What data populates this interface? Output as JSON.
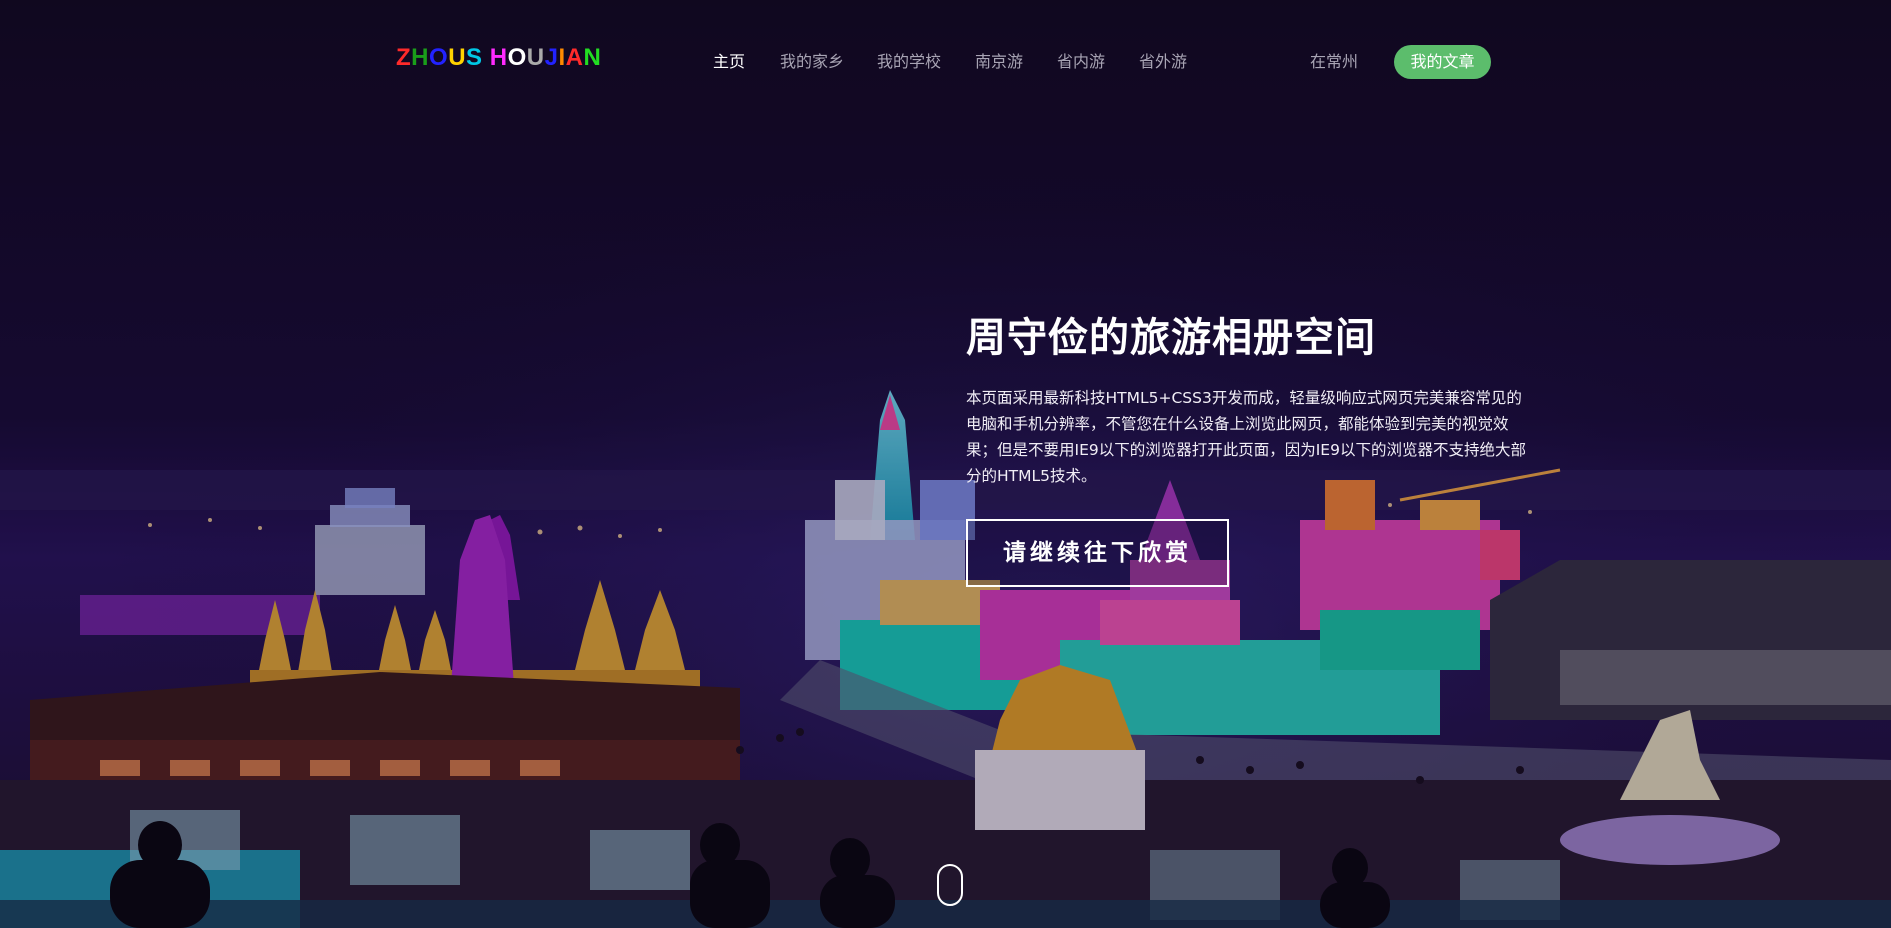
{
  "header": {
    "logo_letters": [
      {
        "char": "Z",
        "color": "#ff2a2a"
      },
      {
        "char": "H",
        "color": "#1a9e1a"
      },
      {
        "char": "O",
        "color": "#2222ff"
      },
      {
        "char": "U",
        "color": "#ffd200"
      },
      {
        "char": "S",
        "color": "#00c8e6"
      },
      {
        "char": " ",
        "color": "#ffffff"
      },
      {
        "char": "H",
        "color": "#ff2aff"
      },
      {
        "char": "O",
        "color": "#ffffff"
      },
      {
        "char": "U",
        "color": "#aaaaaa"
      },
      {
        "char": "J",
        "color": "#2222ff"
      },
      {
        "char": "I",
        "color": "#ff8a00"
      },
      {
        "char": "A",
        "color": "#ff2a2a"
      },
      {
        "char": "N",
        "color": "#22dd22"
      }
    ],
    "nav": [
      {
        "label": "主页",
        "active": true
      },
      {
        "label": "我的家乡"
      },
      {
        "label": "我的学校"
      },
      {
        "label": "南京游"
      },
      {
        "label": "省内游"
      },
      {
        "label": "省外游"
      }
    ],
    "city": "在常州",
    "articles_button": "我的文章",
    "accent_color": "#5cbd6c"
  },
  "hero": {
    "title": "周守俭的旅游相册空间",
    "description": "本页面采用最新科技HTML5+CSS3开发而成，轻量级响应式网页完美兼容常见的电脑和手机分辨率，不管您在什么设备上浏览此网页，都能体验到完美的视觉效果；但是不要用IE9以下的浏览器打开此页面，因为IE9以下的浏览器不支持绝大部分的HTML5技术。",
    "cta": "请继续往下欣赏"
  },
  "background": {
    "icon": "ice-festival-night-photo"
  }
}
